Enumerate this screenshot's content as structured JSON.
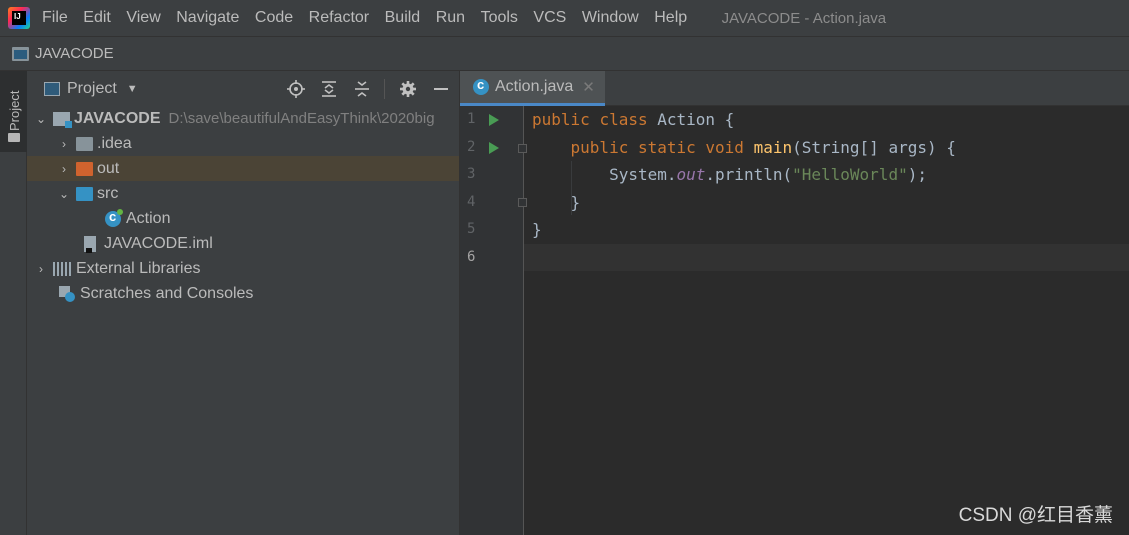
{
  "menubar": {
    "items": [
      "File",
      "Edit",
      "View",
      "Navigate",
      "Code",
      "Refactor",
      "Build",
      "Run",
      "Tools",
      "VCS",
      "Window",
      "Help"
    ],
    "window_title": "JAVACODE - Action.java"
  },
  "navbar": {
    "project": "JAVACODE"
  },
  "side_strip": {
    "tab_label": "Project"
  },
  "project_panel": {
    "title": "Project",
    "tree": [
      {
        "label": "JAVACODE",
        "path": "D:\\save\\beautifulAndEasyThink\\2020big"
      },
      {
        "label": ".idea"
      },
      {
        "label": "out"
      },
      {
        "label": "src"
      },
      {
        "label": "Action"
      },
      {
        "label": "JAVACODE.iml"
      },
      {
        "label": "External Libraries"
      },
      {
        "label": "Scratches and Consoles"
      }
    ]
  },
  "editor": {
    "tab": {
      "label": "Action.java"
    },
    "line_numbers": [
      "1",
      "2",
      "3",
      "4",
      "5",
      "6"
    ],
    "code": {
      "l1_kw1": "public",
      "l1_kw2": "class",
      "l1_name": "Action",
      "l1_rest": " {",
      "l2_kw1": "public",
      "l2_kw2": "static",
      "l2_kw3": "void",
      "l2_fn": "main",
      "l2_rest": "(String[] args) {",
      "l3_a": "System.",
      "l3_field": "out",
      "l3_b": ".println(",
      "l3_str": "\"HelloWorld\"",
      "l3_c": ");",
      "l4": "}",
      "l5": "}"
    }
  },
  "watermark": "CSDN @红目香薰"
}
